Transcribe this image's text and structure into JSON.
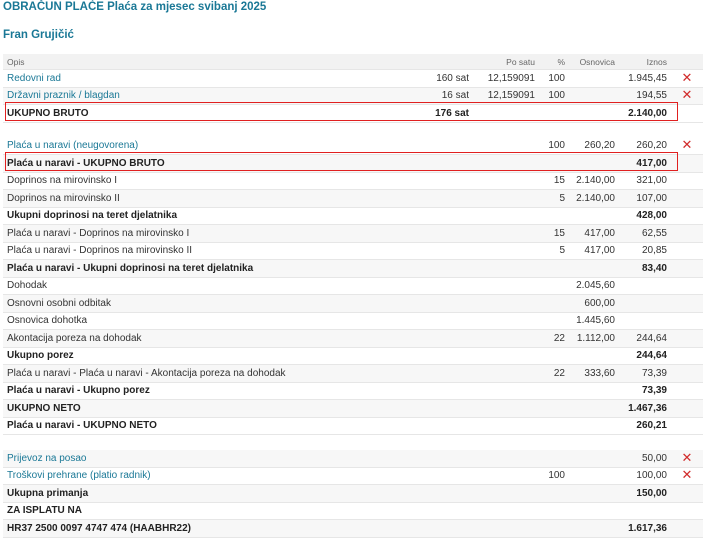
{
  "header": {
    "title": "OBRAČUN PLAĆE Plaća za mjesec svibanj 2025",
    "employee": "Fran Grujičić"
  },
  "columns": {
    "desc": "Opis",
    "hours": "Po satu",
    "pct": "%",
    "base": "Osnovica",
    "amount": "Iznos"
  },
  "rows": [
    {
      "desc": "Redovni rad",
      "hours": "160 sat",
      "rate": "12,159091",
      "pct": "100",
      "base": "",
      "amount": "1.945,45",
      "link": true,
      "del": true
    },
    {
      "desc": "Državni praznik / blagdan",
      "hours": "16 sat",
      "rate": "12,159091",
      "pct": "100",
      "base": "",
      "amount": "194,55",
      "link": true,
      "del": true
    },
    {
      "desc": "UKUPNO BRUTO",
      "hours": "176 sat",
      "rate": "",
      "pct": "",
      "base": "",
      "amount": "2.140,00",
      "bold": true
    },
    {
      "desc": "Plaća u naravi (neugovorena)",
      "hours": "",
      "rate": "",
      "pct": "100",
      "base": "260,20",
      "amount": "260,20",
      "link": true,
      "del": true
    },
    {
      "desc": "Plaća u naravi - UKUPNO BRUTO",
      "hours": "",
      "rate": "",
      "pct": "",
      "base": "",
      "amount": "417,00",
      "bold": true
    },
    {
      "desc": "Doprinos na mirovinsko I",
      "hours": "",
      "rate": "",
      "pct": "15",
      "base": "2.140,00",
      "amount": "321,00"
    },
    {
      "desc": "Doprinos na mirovinsko II",
      "hours": "",
      "rate": "",
      "pct": "5",
      "base": "2.140,00",
      "amount": "107,00"
    },
    {
      "desc": "Ukupni doprinosi na teret djelatnika",
      "hours": "",
      "rate": "",
      "pct": "",
      "base": "",
      "amount": "428,00",
      "bold": true
    },
    {
      "desc": "Plaća u naravi - Doprinos na mirovinsko I",
      "hours": "",
      "rate": "",
      "pct": "15",
      "base": "417,00",
      "amount": "62,55"
    },
    {
      "desc": "Plaća u naravi - Doprinos na mirovinsko II",
      "hours": "",
      "rate": "",
      "pct": "5",
      "base": "417,00",
      "amount": "20,85"
    },
    {
      "desc": "Plaća u naravi - Ukupni doprinosi na teret djelatnika",
      "hours": "",
      "rate": "",
      "pct": "",
      "base": "",
      "amount": "83,40",
      "bold": true
    },
    {
      "desc": "Dohodak",
      "hours": "",
      "rate": "",
      "pct": "",
      "base": "2.045,60",
      "amount": ""
    },
    {
      "desc": "Osnovni osobni odbitak",
      "hours": "",
      "rate": "",
      "pct": "",
      "base": "600,00",
      "amount": ""
    },
    {
      "desc": "Osnovica dohotka",
      "hours": "",
      "rate": "",
      "pct": "",
      "base": "1.445,60",
      "amount": ""
    },
    {
      "desc": "Akontacija poreza na dohodak",
      "hours": "",
      "rate": "",
      "pct": "22",
      "base": "1.112,00",
      "amount": "244,64"
    },
    {
      "desc": "Ukupno porez",
      "hours": "",
      "rate": "",
      "pct": "",
      "base": "",
      "amount": "244,64",
      "bold": true
    },
    {
      "desc": "Plaća u naravi - Plaća u naravi - Akontacija poreza na dohodak",
      "hours": "",
      "rate": "",
      "pct": "22",
      "base": "333,60",
      "amount": "73,39"
    },
    {
      "desc": "Plaća u naravi - Ukupno porez",
      "hours": "",
      "rate": "",
      "pct": "",
      "base": "",
      "amount": "73,39",
      "bold": true
    },
    {
      "desc": "UKUPNO NETO",
      "hours": "",
      "rate": "",
      "pct": "",
      "base": "",
      "amount": "1.467,36",
      "bold": true
    },
    {
      "desc": "Plaća u naravi - UKUPNO NETO",
      "hours": "",
      "rate": "",
      "pct": "",
      "base": "",
      "amount": "260,21",
      "bold": true
    },
    {
      "desc": "Prijevoz na posao",
      "hours": "",
      "rate": "",
      "pct": "",
      "base": "",
      "amount": "50,00",
      "link": true,
      "del": true
    },
    {
      "desc": "Troškovi prehrane (platio radnik)",
      "hours": "",
      "rate": "",
      "pct": "100",
      "base": "",
      "amount": "100,00",
      "link": true,
      "del": true
    },
    {
      "desc": "Ukupna primanja",
      "hours": "",
      "rate": "",
      "pct": "",
      "base": "",
      "amount": "150,00",
      "bold": true
    },
    {
      "desc": "ZA ISPLATU NA",
      "hours": "",
      "rate": "",
      "pct": "",
      "base": "",
      "amount": "",
      "bold": true
    },
    {
      "desc": "HR37 2500 0097 4747 474 (HAABHR22)",
      "hours": "",
      "rate": "",
      "pct": "",
      "base": "",
      "amount": "1.617,36",
      "bold": true
    }
  ],
  "icons": {
    "delete": "close-icon",
    "delete_glyph": "✕"
  },
  "colors": {
    "accent": "#1a7896",
    "delete": "#d12b2b",
    "highlight": "#e02020"
  }
}
